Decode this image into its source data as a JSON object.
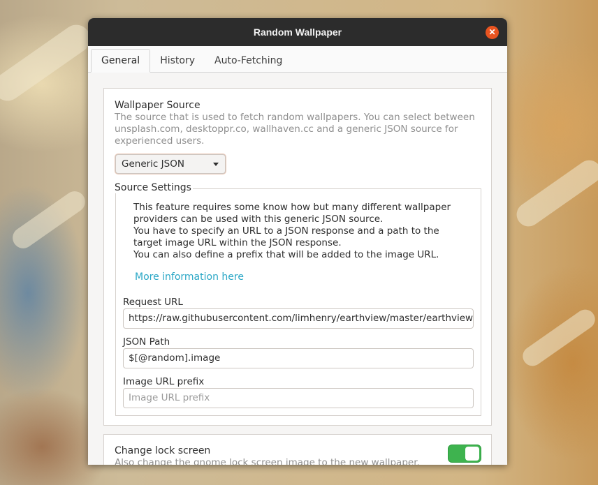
{
  "window": {
    "title": "Random Wallpaper",
    "close_glyph": "✕"
  },
  "tabs": [
    {
      "label": "General",
      "active": true
    },
    {
      "label": "History",
      "active": false
    },
    {
      "label": "Auto-Fetching",
      "active": false
    }
  ],
  "general": {
    "wallpaper_source": {
      "title": "Wallpaper Source",
      "description": "The source that is used to fetch random wallpapers. You can select between unsplash.com, desktoppr.co, wallhaven.cc and a generic JSON source for experienced users.",
      "selected": "Generic JSON"
    },
    "source_settings": {
      "title": "Source Settings",
      "info_lines": [
        "This feature requires some know how but many different wallpaper providers can be used with this generic JSON source.",
        "You have to specify an URL to a JSON response and a path to the target image URL within the JSON response.",
        "You can also define a prefix that will be added to the image URL."
      ],
      "more_link": "More information here",
      "request_url": {
        "label": "Request URL",
        "value": "https://raw.githubusercontent.com/limhenry/earthview/master/earthview.json"
      },
      "json_path": {
        "label": "JSON Path",
        "value": "$[@random].image"
      },
      "image_url_prefix": {
        "label": "Image URL prefix",
        "value": "",
        "placeholder": "Image URL prefix"
      }
    },
    "lock_screen": {
      "title": "Change lock screen",
      "description": "Also change the gnome lock screen image to the new wallpaper.",
      "enabled": true
    }
  },
  "colors": {
    "accent_close": "#e95420",
    "link": "#2aa7c6",
    "toggle_on": "#3eb34f",
    "titlebar": "#2c2c2c"
  }
}
